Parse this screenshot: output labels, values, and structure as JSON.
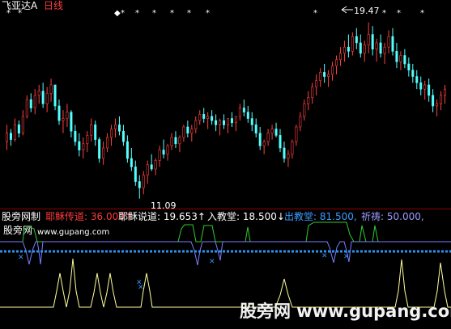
{
  "header": {
    "stock_name": "飞亚达A",
    "period": "日线"
  },
  "price_chart": {
    "high_label": "19.47",
    "low_label": "11.09",
    "candles": [
      [
        14.6,
        13.4,
        13.8,
        14.2
      ],
      [
        14.4,
        13.6,
        14.2,
        13.9
      ],
      [
        14.9,
        13.8,
        13.9,
        14.6
      ],
      [
        14.8,
        14.0,
        14.6,
        14.2
      ],
      [
        15.3,
        14.1,
        14.2,
        15.0
      ],
      [
        16.0,
        14.9,
        15.0,
        15.8
      ],
      [
        16.1,
        15.2,
        15.8,
        15.4
      ],
      [
        16.3,
        15.1,
        15.4,
        16.0
      ],
      [
        16.5,
        15.6,
        16.0,
        16.2
      ],
      [
        16.6,
        15.4,
        16.2,
        15.6
      ],
      [
        16.4,
        15.2,
        15.6,
        16.1
      ],
      [
        16.8,
        15.7,
        16.1,
        16.5
      ],
      [
        16.5,
        15.3,
        16.5,
        15.5
      ],
      [
        15.8,
        14.6,
        15.5,
        14.8
      ],
      [
        15.3,
        14.2,
        14.8,
        14.9
      ],
      [
        15.6,
        14.5,
        14.9,
        15.2
      ],
      [
        15.3,
        14.0,
        15.2,
        14.3
      ],
      [
        14.6,
        13.6,
        14.3,
        13.8
      ],
      [
        14.2,
        13.1,
        13.8,
        13.4
      ],
      [
        14.0,
        13.0,
        13.4,
        13.7
      ],
      [
        14.3,
        13.3,
        13.7,
        14.1
      ],
      [
        14.9,
        13.8,
        14.1,
        14.6
      ],
      [
        14.8,
        13.6,
        14.6,
        13.9
      ],
      [
        14.0,
        12.8,
        13.9,
        13.0
      ],
      [
        13.8,
        12.7,
        13.0,
        13.5
      ],
      [
        14.2,
        13.3,
        13.5,
        14.0
      ],
      [
        14.6,
        13.6,
        14.0,
        14.4
      ],
      [
        14.9,
        14.0,
        14.4,
        14.6
      ],
      [
        15.0,
        14.1,
        14.6,
        14.3
      ],
      [
        14.6,
        13.6,
        14.3,
        13.8
      ],
      [
        14.1,
        12.8,
        13.8,
        13.0
      ],
      [
        13.5,
        12.4,
        13.0,
        12.6
      ],
      [
        12.9,
        11.7,
        12.6,
        11.9
      ],
      [
        12.2,
        11.09,
        11.9,
        11.6
      ],
      [
        12.4,
        11.3,
        11.6,
        12.2
      ],
      [
        12.9,
        11.8,
        12.2,
        12.7
      ],
      [
        13.2,
        12.4,
        12.7,
        12.5
      ],
      [
        13.0,
        12.2,
        12.5,
        12.9
      ],
      [
        13.6,
        12.6,
        12.9,
        13.4
      ],
      [
        13.9,
        13.0,
        13.4,
        13.2
      ],
      [
        13.7,
        12.9,
        13.2,
        13.6
      ],
      [
        14.2,
        13.4,
        13.6,
        14.0
      ],
      [
        14.3,
        13.5,
        14.0,
        13.7
      ],
      [
        14.1,
        13.3,
        13.7,
        14.0
      ],
      [
        14.6,
        13.8,
        14.0,
        14.5
      ],
      [
        14.8,
        14.0,
        14.5,
        14.2
      ],
      [
        14.6,
        13.8,
        14.2,
        14.4
      ],
      [
        15.0,
        14.2,
        14.4,
        14.8
      ],
      [
        15.3,
        14.6,
        14.8,
        15.1
      ],
      [
        15.4,
        14.7,
        15.1,
        14.9
      ],
      [
        15.2,
        14.4,
        14.9,
        15.0
      ],
      [
        15.3,
        14.6,
        15.0,
        14.8
      ],
      [
        15.1,
        14.3,
        14.8,
        14.6
      ],
      [
        14.9,
        14.1,
        14.6,
        14.8
      ],
      [
        15.1,
        14.4,
        14.8,
        14.6
      ],
      [
        14.9,
        14.2,
        14.6,
        14.9
      ],
      [
        15.2,
        14.5,
        14.9,
        14.7
      ],
      [
        15.0,
        14.3,
        14.7,
        15.0
      ],
      [
        15.6,
        14.8,
        15.0,
        15.4
      ],
      [
        15.8,
        15.0,
        15.4,
        15.2
      ],
      [
        15.5,
        14.7,
        15.2,
        14.9
      ],
      [
        15.2,
        14.3,
        14.9,
        14.6
      ],
      [
        14.9,
        14.0,
        14.6,
        14.2
      ],
      [
        14.5,
        13.4,
        14.2,
        13.6
      ],
      [
        13.9,
        13.2,
        13.6,
        13.8
      ],
      [
        14.4,
        13.6,
        13.8,
        14.2
      ],
      [
        14.6,
        13.9,
        14.2,
        14.4
      ],
      [
        14.7,
        14.0,
        14.4,
        14.1
      ],
      [
        14.4,
        13.3,
        14.1,
        13.5
      ],
      [
        13.8,
        12.8,
        13.5,
        13.0
      ],
      [
        13.4,
        12.6,
        13.0,
        13.2
      ],
      [
        13.9,
        13.0,
        13.2,
        13.8
      ],
      [
        14.6,
        13.6,
        13.8,
        14.5
      ],
      [
        15.2,
        14.3,
        14.5,
        15.0
      ],
      [
        15.8,
        14.8,
        15.0,
        15.6
      ],
      [
        16.2,
        15.3,
        15.6,
        15.9
      ],
      [
        16.6,
        15.6,
        15.9,
        16.4
      ],
      [
        17.0,
        16.0,
        16.4,
        16.7
      ],
      [
        17.3,
        16.4,
        16.7,
        17.1
      ],
      [
        17.5,
        16.6,
        17.1,
        16.9
      ],
      [
        17.2,
        16.4,
        16.9,
        17.0
      ],
      [
        17.6,
        16.7,
        17.0,
        17.4
      ],
      [
        17.9,
        17.0,
        17.4,
        17.7
      ],
      [
        18.3,
        17.4,
        17.7,
        18.0
      ],
      [
        18.6,
        17.6,
        18.0,
        18.3
      ],
      [
        18.9,
        17.8,
        18.3,
        18.1
      ],
      [
        19.0,
        17.9,
        18.1,
        18.8
      ],
      [
        19.2,
        18.2,
        18.8,
        18.5
      ],
      [
        18.9,
        17.8,
        18.5,
        18.0
      ],
      [
        18.6,
        17.6,
        18.0,
        18.4
      ],
      [
        19.47,
        18.0,
        18.4,
        18.9
      ],
      [
        19.3,
        17.9,
        18.9,
        18.2
      ],
      [
        18.7,
        17.6,
        18.2,
        18.5
      ],
      [
        18.9,
        17.8,
        18.5,
        18.0
      ],
      [
        18.5,
        17.5,
        18.0,
        18.3
      ],
      [
        19.1,
        18.0,
        18.3,
        18.8
      ],
      [
        19.2,
        17.9,
        18.8,
        18.1
      ],
      [
        18.5,
        17.3,
        18.1,
        17.6
      ],
      [
        18.1,
        17.2,
        17.6,
        17.9
      ],
      [
        18.2,
        17.3,
        17.9,
        17.5
      ],
      [
        17.8,
        16.9,
        17.5,
        17.2
      ],
      [
        17.5,
        16.6,
        17.2,
        16.9
      ],
      [
        17.2,
        16.3,
        16.9,
        16.6
      ],
      [
        16.9,
        16.0,
        16.6,
        16.3
      ],
      [
        16.7,
        15.8,
        16.3,
        16.5
      ],
      [
        16.8,
        15.7,
        16.5,
        16.0
      ],
      [
        16.3,
        15.2,
        16.0,
        15.5
      ],
      [
        15.8,
        15.0,
        15.5,
        15.6
      ],
      [
        16.2,
        15.3,
        15.6,
        16.0
      ],
      [
        16.5,
        15.6,
        16.0,
        16.3
      ]
    ],
    "markers": [
      "*",
      "*",
      "◆",
      "*",
      "*",
      "*",
      "*",
      "*",
      "*",
      "*"
    ],
    "up_arrow": "▲"
  },
  "indicator": {
    "title": "股旁网制",
    "brand": "股旁网",
    "url": "www.gupang.com",
    "readouts": [
      {
        "label": "耶稣传道:",
        "value": "36.000",
        "arrow": "↑",
        "color": "#ff3b3b"
      },
      {
        "label": "耶稣说道:",
        "value": "19.653",
        "arrow": "↑",
        "color": "#ffffff"
      },
      {
        "label": "入教堂:",
        "value": "18.500",
        "arrow": "↓",
        "color": "#ffffff"
      },
      {
        "label": "出教堂:",
        "value": "81.500",
        "arrow": ",",
        "color": "#3c9cff"
      },
      {
        "label": "祈祷:",
        "value": "50.000",
        "arrow": ",",
        "color": "#9c9cff"
      }
    ]
  },
  "watermark": {
    "text": "股旁网 www.gupang.com"
  },
  "colors": {
    "background": "#000000",
    "up_candle": "#ff4040",
    "down_candle": "#54ffff",
    "green_line": "#2ecc2e",
    "violet_line": "#7c7cff",
    "dot_line": "#2f8ff0",
    "yellow_line": "#ffff9c",
    "separator": "#8b0000"
  }
}
